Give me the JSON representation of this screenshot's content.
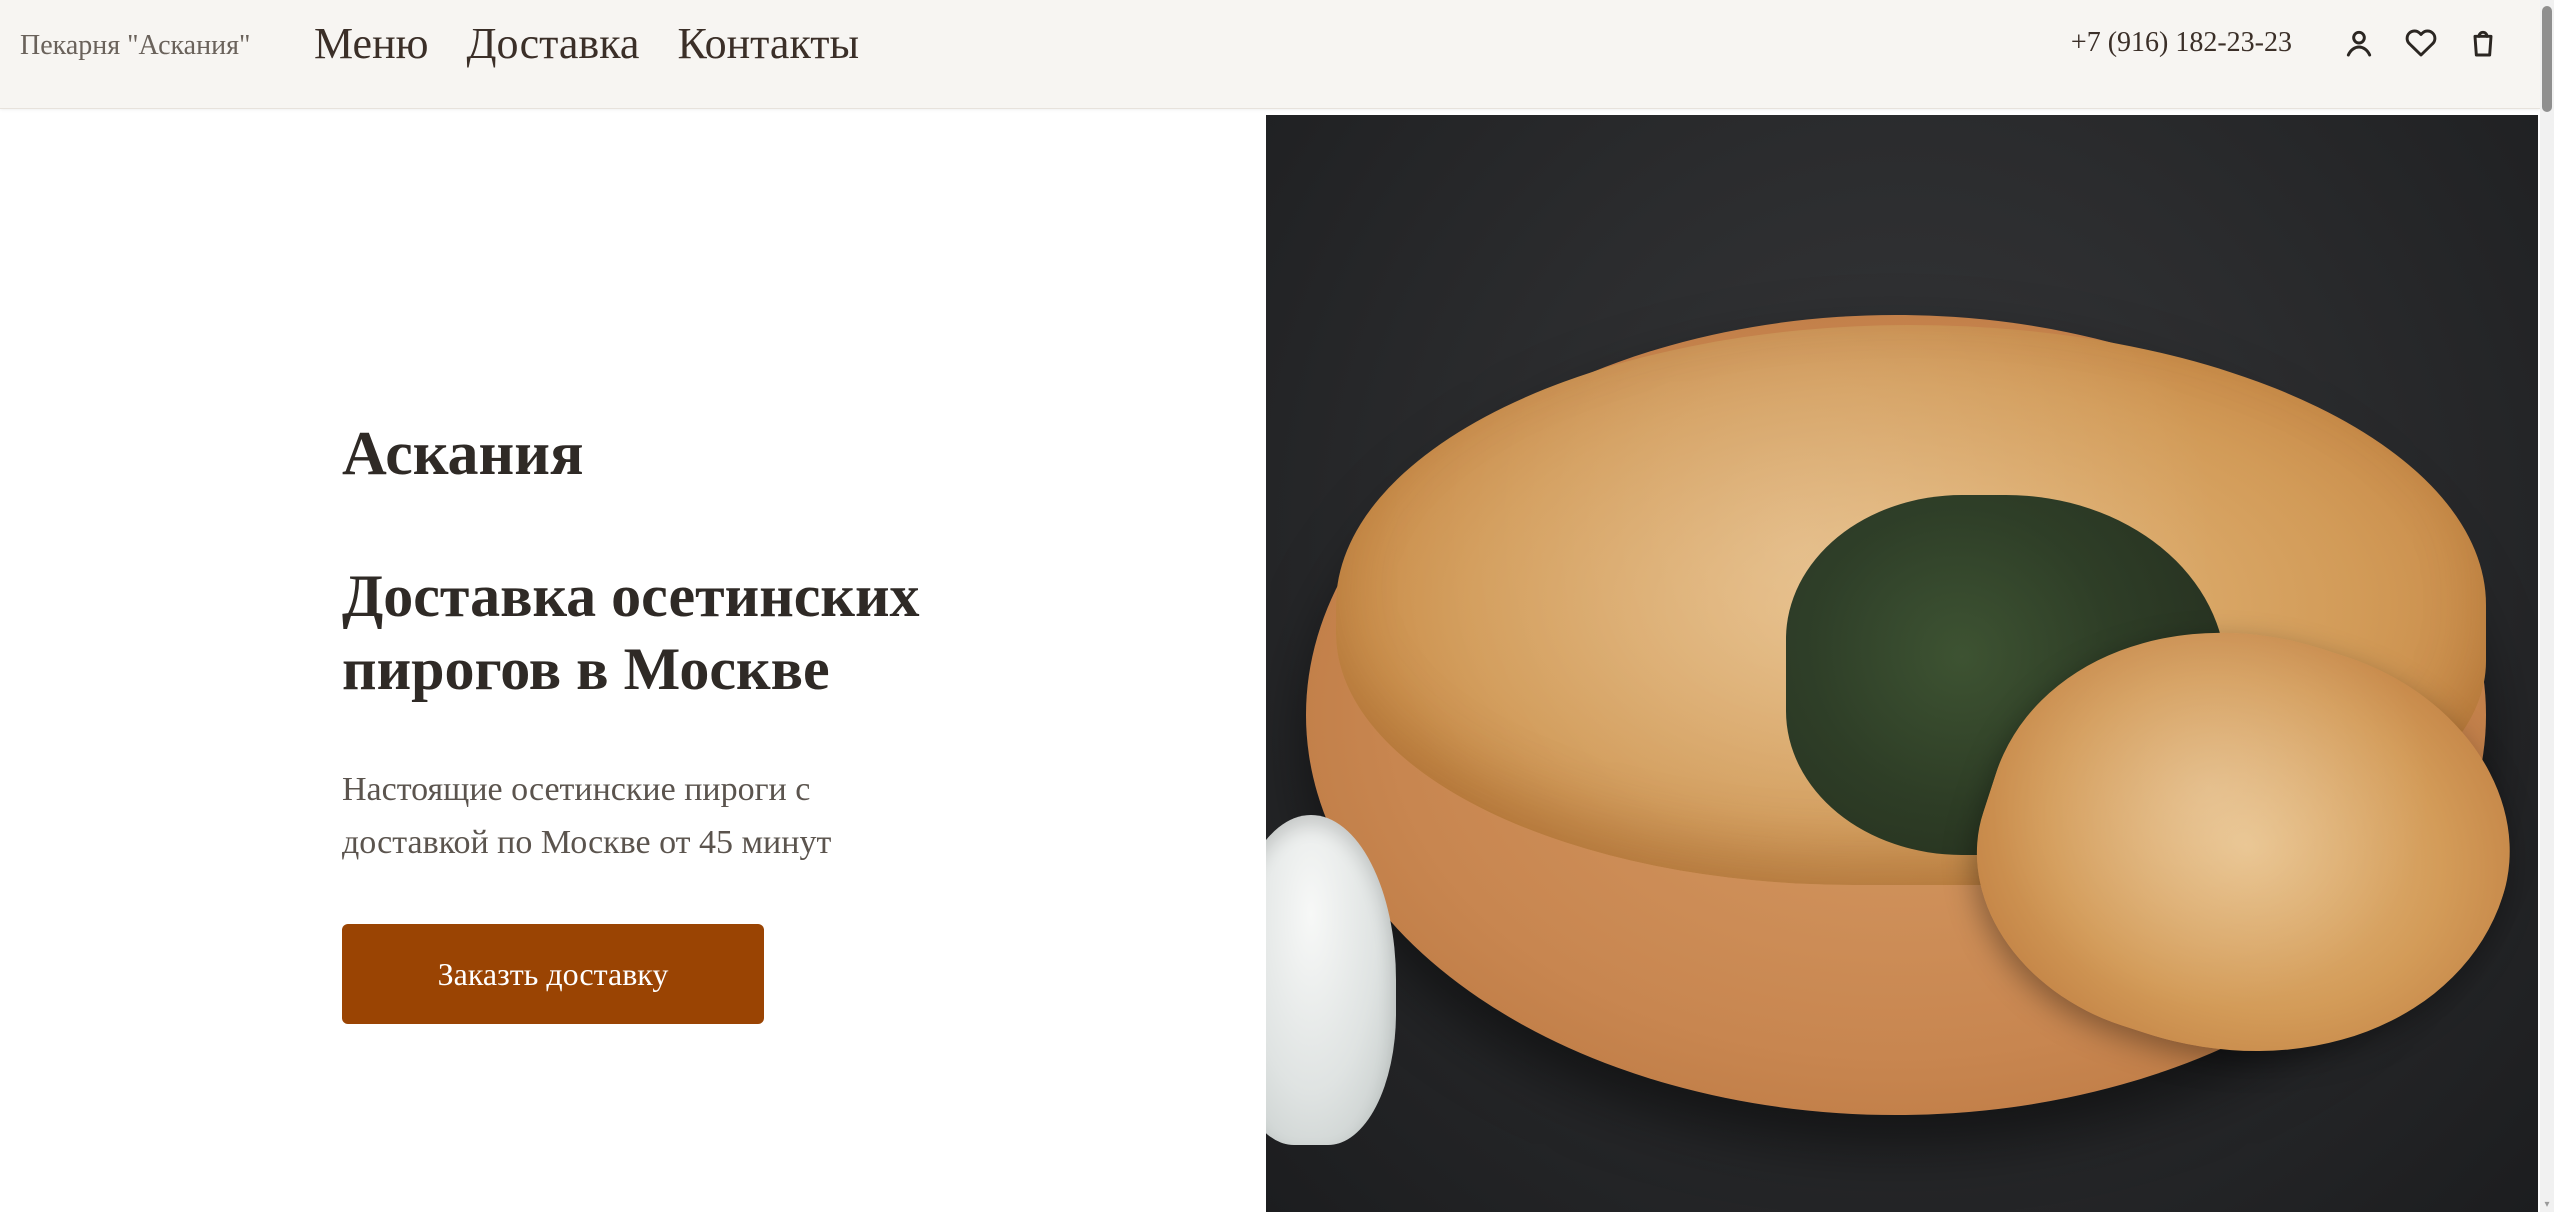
{
  "header": {
    "brand": "Пекарня \"Аскания\"",
    "nav": [
      "Меню",
      "Доставка",
      "Контакты"
    ],
    "phone": "+7 (916) 182-23-23",
    "icons": [
      "user-icon",
      "heart-icon",
      "bag-icon"
    ]
  },
  "hero": {
    "title": "Аскания",
    "subtitle": "Доставка осетинских пирогов в Москве",
    "description": "Настоящие осетинские пироги с доставкой по Москве от 45 минут",
    "cta_label": "Заказть доставку"
  },
  "colors": {
    "header_bg": "#f7f5f2",
    "cta_bg": "#9a4403",
    "text_dark": "#2f2a26"
  }
}
